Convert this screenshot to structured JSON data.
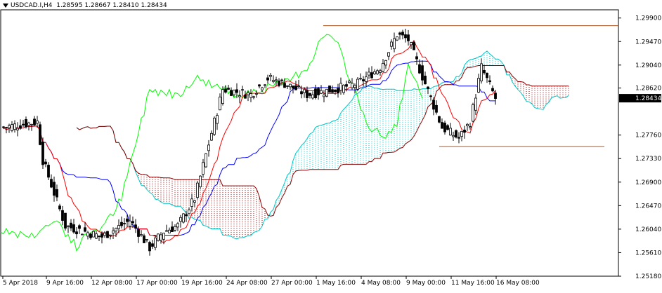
{
  "chart_data": {
    "type": "candlestick",
    "symbol": "USDCAD.I,H4",
    "ohlc_header": [
      "1.28595",
      "1.28667",
      "1.28410",
      "1.28434"
    ],
    "current_price": "1.28434",
    "y_ticks": [
      "1.29900",
      "1.29470",
      "1.29040",
      "1.28620",
      "1.28434",
      "1.27760",
      "1.27330",
      "1.26900",
      "1.26470",
      "1.26040",
      "1.25610",
      "1.25180"
    ],
    "x_ticks": [
      "5 Apr 2018",
      "9 Apr 16:00",
      "12 Apr 08:00",
      "17 Apr 00:00",
      "19 Apr 16:00",
      "24 Apr 08:00",
      "27 Apr 00:00",
      "1 May 16:00",
      "4 May 08:00",
      "9 May 00:00",
      "11 May 16:00",
      "16 May 08:00"
    ],
    "ylim": [
      1.2518,
      1.3005
    ],
    "horizontal_levels": [
      1.2976,
      1.2755
    ],
    "colors": {
      "background": "#ffffff",
      "tenkan": "#ff0000",
      "kijun": "#0000ff",
      "chikou": "#00ff00",
      "senkou_bull": "#00c8c8",
      "senkou_bear": "#8b0000",
      "levels": "#b05020"
    }
  }
}
